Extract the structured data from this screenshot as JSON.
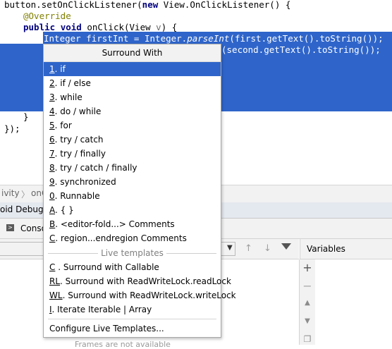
{
  "editor": {
    "line1": "button.setOnClickListener(",
    "line1_kw": "new",
    "line1_rest": " View.OnClickListener() {",
    "override": "@Override",
    "kw_public": "public",
    "kw_void": "void",
    "method_sig_a": " onClick(View ",
    "param_v": "v",
    "method_sig_b": ") {",
    "sel_line1_a": "Integer firstInt = Integer.",
    "sel_line1_it": "parseInt",
    "sel_line1_b": "(first.getText().toString());",
    "sel_line2_visible": "(second.getText().toString());",
    "close_brace": "}",
    "close_call": "});"
  },
  "navbar": {
    "crumb1": "ivity",
    "sep": "〉",
    "crumb2": "onC"
  },
  "toolwindow": {
    "tab_label": "oid Debugg",
    "console_label": "Conso",
    "variables_label": "Variables",
    "frames_hint": "Frames are not available"
  },
  "popup": {
    "title": "Surround With",
    "items": [
      {
        "mn": "1",
        "rest": ". if"
      },
      {
        "mn": "2",
        "rest": ". if / else"
      },
      {
        "mn": "3",
        "rest": ". while"
      },
      {
        "mn": "4",
        "rest": ". do / while"
      },
      {
        "mn": "5",
        "rest": ". for"
      },
      {
        "mn": "6",
        "rest": ". try / catch"
      },
      {
        "mn": "7",
        "rest": ". try / finally"
      },
      {
        "mn": "8",
        "rest": ". try / catch / finally"
      },
      {
        "mn": "9",
        "rest": ". synchronized"
      },
      {
        "mn": "0",
        "rest": ". Runnable"
      },
      {
        "mn": "A",
        "rest": ". { }"
      },
      {
        "mn": "B",
        "rest": ". <editor-fold...> Comments"
      },
      {
        "mn": "C",
        "rest": ". region...endregion Comments"
      }
    ],
    "live_templates_label": "Live templates",
    "live_items": [
      {
        "mn": "C",
        "rest": " . Surround with Callable"
      },
      {
        "mn": "RL",
        "rest": ". Surround with ReadWriteLock.readLock"
      },
      {
        "mn": "WL",
        "rest": ". Surround with ReadWriteLock.writeLock"
      },
      {
        "mn": "I",
        "rest": ". Iterate Iterable | Array"
      }
    ],
    "configure": "Configure Live Templates..."
  },
  "colors": {
    "selection": "#2f65ca",
    "keyword": "#000080",
    "annotation": "#808000"
  },
  "icons": {
    "console": "console-icon",
    "dropdown": "chevron-down-icon",
    "up": "arrow-up-icon",
    "down": "arrow-down-icon",
    "filter": "filter-icon",
    "add": "plus-icon",
    "remove": "minus-icon"
  }
}
